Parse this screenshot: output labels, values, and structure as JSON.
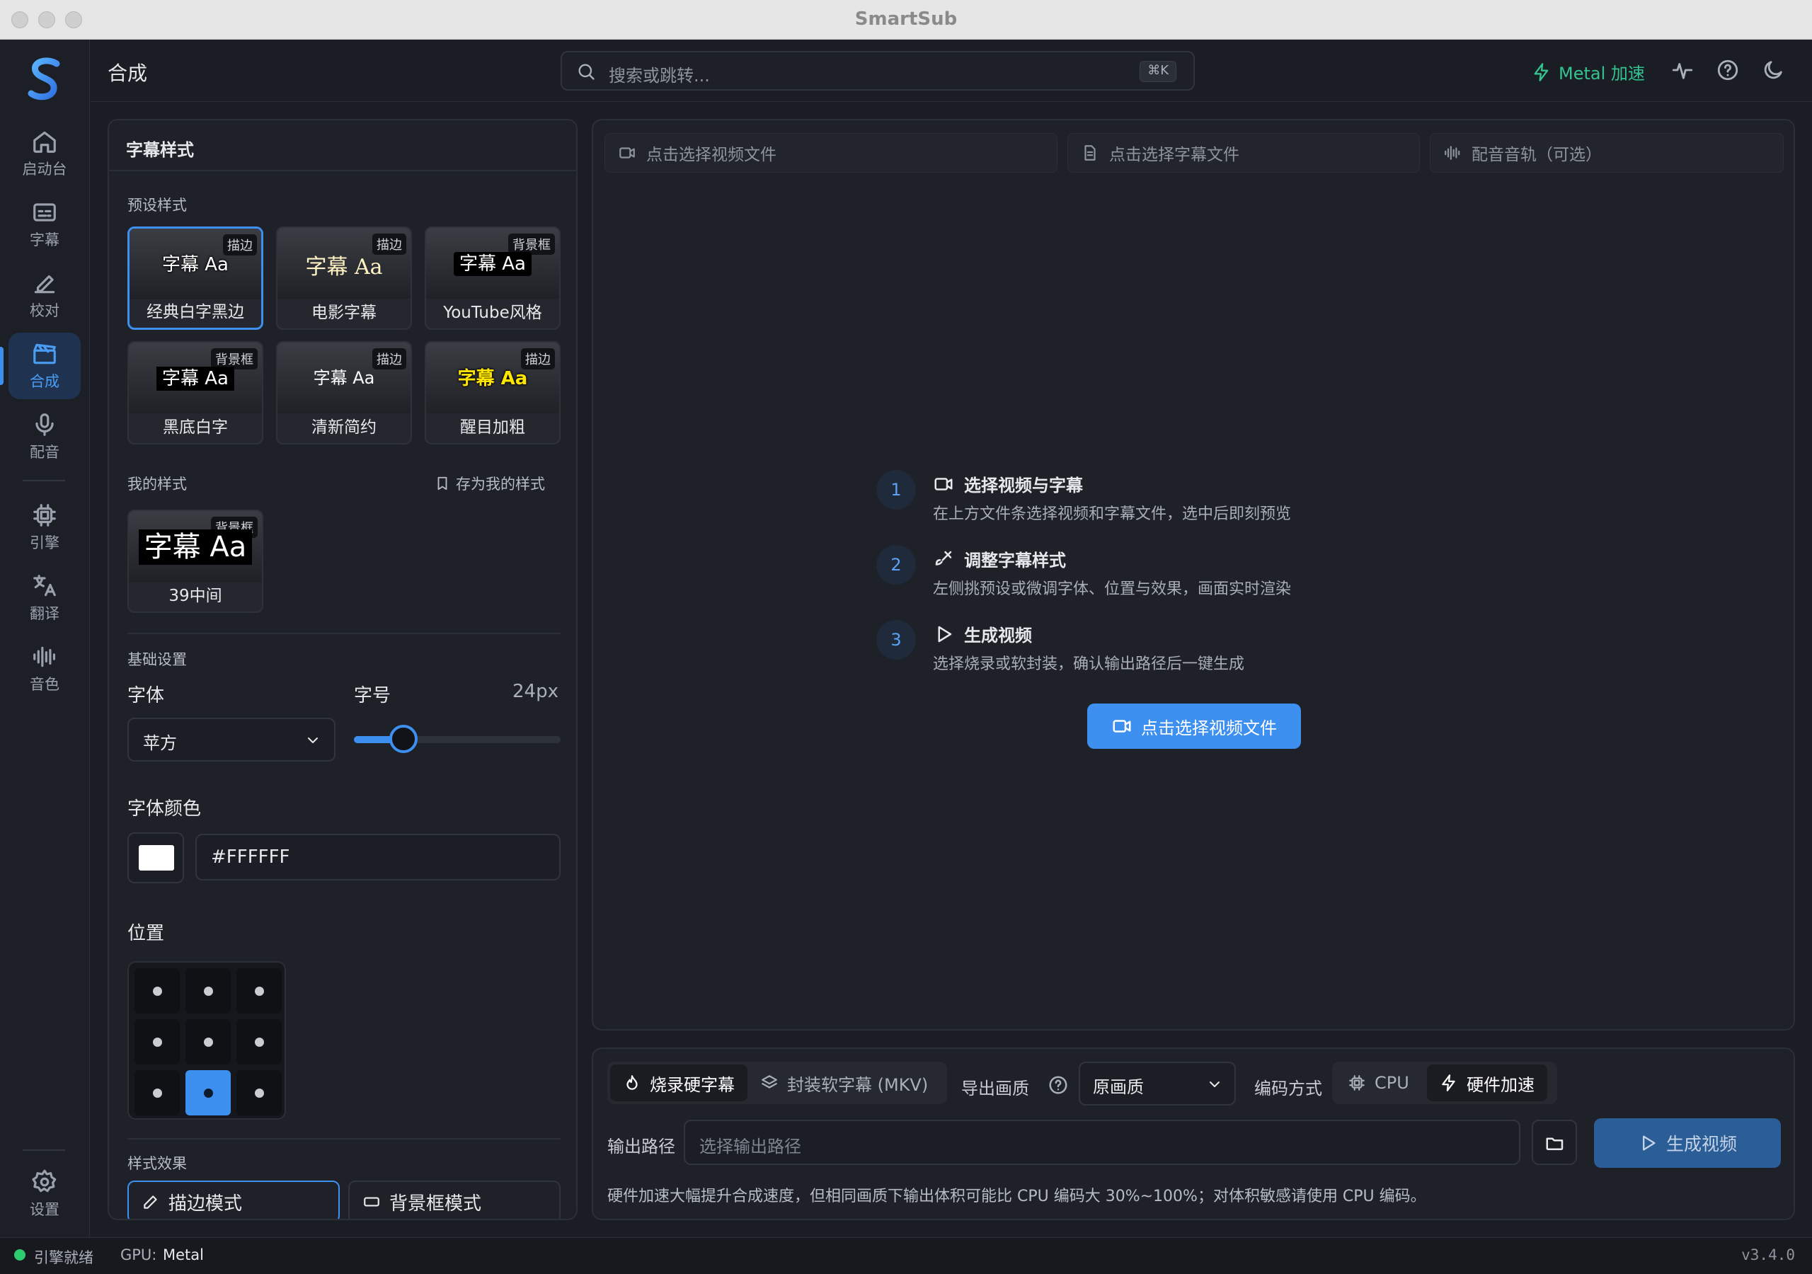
{
  "window": {
    "title": "SmartSub"
  },
  "sidebar": {
    "items": [
      {
        "label": "启动台",
        "icon": "home-icon"
      },
      {
        "label": "字幕",
        "icon": "subtitles-icon"
      },
      {
        "label": "校对",
        "icon": "pen-icon"
      },
      {
        "label": "合成",
        "icon": "clapperboard-icon",
        "active": true
      },
      {
        "label": "配音",
        "icon": "microphone-icon"
      },
      {
        "label": "引擎",
        "icon": "cpu-chip-icon"
      },
      {
        "label": "翻译",
        "icon": "translate-icon"
      },
      {
        "label": "音色",
        "icon": "audio-wave-icon"
      }
    ],
    "settings": "设置"
  },
  "header": {
    "title": "合成",
    "search_placeholder": "搜索或跳转...",
    "shortcut": "⌘K",
    "metal": "Metal 加速",
    "accent": "#3d8ff0",
    "metal_color": "#34c38f"
  },
  "style_panel": {
    "title": "字幕样式",
    "presets_label": "预设样式",
    "presets": [
      {
        "name": "经典白字黑边",
        "tag": "描边",
        "sample": "字幕 Aa",
        "selected": true
      },
      {
        "name": "电影字幕",
        "tag": "描边",
        "sample": "字幕 Aa"
      },
      {
        "name": "YouTube风格",
        "tag": "背景框",
        "sample": "字幕 Aa"
      },
      {
        "name": "黑底白字",
        "tag": "背景框",
        "sample": "字幕 Aa"
      },
      {
        "name": "清新简约",
        "tag": "描边",
        "sample": "字幕 Aa"
      },
      {
        "name": "醒目加粗",
        "tag": "描边",
        "sample": "字幕 Aa"
      }
    ],
    "my_styles_label": "我的样式",
    "save_label": "存为我的样式",
    "my_styles": [
      {
        "name": "39中间",
        "tag": "背景框",
        "sample": "字幕 Aa"
      }
    ],
    "basic_label": "基础设置",
    "font_label": "字体",
    "font_value": "苹方",
    "size_label": "字号",
    "size_value": "24px",
    "size_fraction": 0.24,
    "color_label": "字体颜色",
    "color_value": "#FFFFFF",
    "position_label": "位置",
    "position_selected": "bottom-center",
    "effects_label": "样式效果",
    "modes": [
      "描边模式",
      "背景框模式"
    ]
  },
  "files": {
    "video": "点击选择视频文件",
    "subtitle": "点击选择字幕文件",
    "audio": "配音音轨（可选）"
  },
  "steps": [
    {
      "n": "1",
      "title": "选择视频与字幕",
      "desc": "在上方文件条选择视频和字幕文件，选中后即刻预览",
      "icon": "video-camera-icon"
    },
    {
      "n": "2",
      "title": "调整字幕样式",
      "desc": "左侧挑预设或微调字体、位置与效果，画面实时渲染",
      "icon": "brush-icon"
    },
    {
      "n": "3",
      "title": "生成视频",
      "desc": "选择烧录或软封装，确认输出路径后一键生成",
      "icon": "play-icon"
    }
  ],
  "cta": "点击选择视频文件",
  "output": {
    "modes": [
      "烧录硬字幕",
      "封装软字幕 (MKV)"
    ],
    "quality_label": "导出画质",
    "quality_value": "原画质",
    "encode_label": "编码方式",
    "encode_options": [
      "CPU",
      "硬件加速"
    ],
    "path_label": "输出路径",
    "path_placeholder": "选择输出路径",
    "generate": "生成视频",
    "note": "硬件加速大幅提升合成速度，但相同画质下输出体积可能比 CPU 编码大 30%~100%；对体积敏感请使用 CPU 编码。"
  },
  "status": {
    "engine": "引擎就绪",
    "gpu_label": "GPU:",
    "gpu_value": "Metal",
    "version": "v3.4.0"
  }
}
